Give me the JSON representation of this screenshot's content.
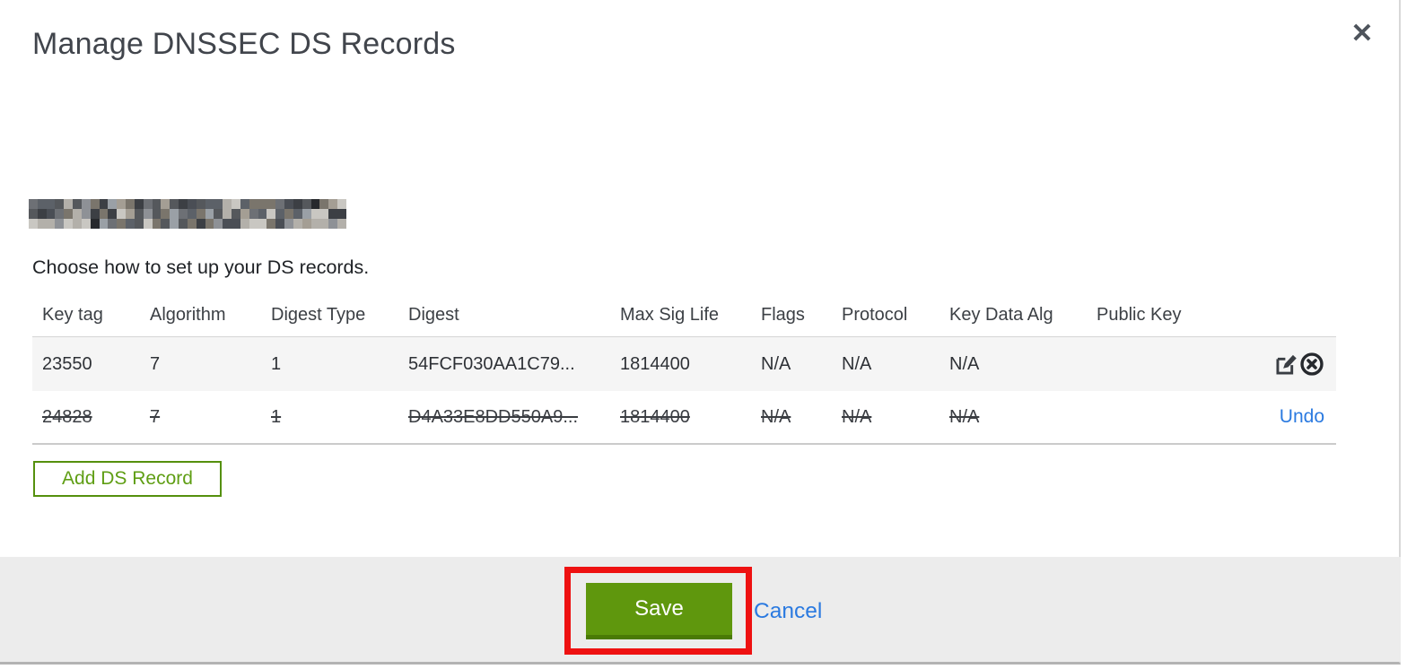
{
  "modal": {
    "title": "Manage DNSSEC DS Records",
    "close_glyph": "✕",
    "instruction": "Choose how to set up your DS records.",
    "table": {
      "columns": [
        "Key tag",
        "Algorithm",
        "Digest Type",
        "Digest",
        "Max Sig Life",
        "Flags",
        "Protocol",
        "Key Data Alg",
        "Public Key"
      ],
      "rows": [
        {
          "key_tag": "23550",
          "algorithm": "7",
          "digest_type": "1",
          "digest": "54FCF030AA1C79...",
          "max_sig_life": "1814400",
          "flags": "N/A",
          "protocol": "N/A",
          "key_data_alg": "N/A",
          "public_key": "",
          "state": "normal"
        },
        {
          "key_tag": "24828",
          "algorithm": "7",
          "digest_type": "1",
          "digest": "D4A33E8DD550A9...",
          "max_sig_life": "1814400",
          "flags": "N/A",
          "protocol": "N/A",
          "key_data_alg": "N/A",
          "public_key": "",
          "state": "deleted",
          "undo_label": "Undo"
        }
      ]
    },
    "add_button_label": "Add DS Record",
    "footer": {
      "save_label": "Save",
      "cancel_label": "Cancel"
    }
  },
  "icons": {
    "close": "close-icon",
    "edit": "edit-record-icon",
    "delete": "delete-record-icon"
  },
  "colors": {
    "button_green": "#5f970d",
    "button_green_shadow": "#4a7a06",
    "outline_green": "#55900d",
    "link_blue": "#2b7ae0",
    "annotation_red": "#ee1111",
    "footer_gray": "#ececec",
    "row_gray": "#f5f5f5",
    "text_dark": "#2e3136"
  },
  "redaction": {
    "rows": 3,
    "cols": 36,
    "palette": [
      "#3c3f44",
      "#55585c",
      "#6d7075",
      "#8e9196",
      "#b3b0aa",
      "#c9c7c2",
      "#4a4e55",
      "#27292d",
      "#9aa0a6",
      "#7a756c",
      "#5c6168",
      "#a49e94"
    ]
  }
}
